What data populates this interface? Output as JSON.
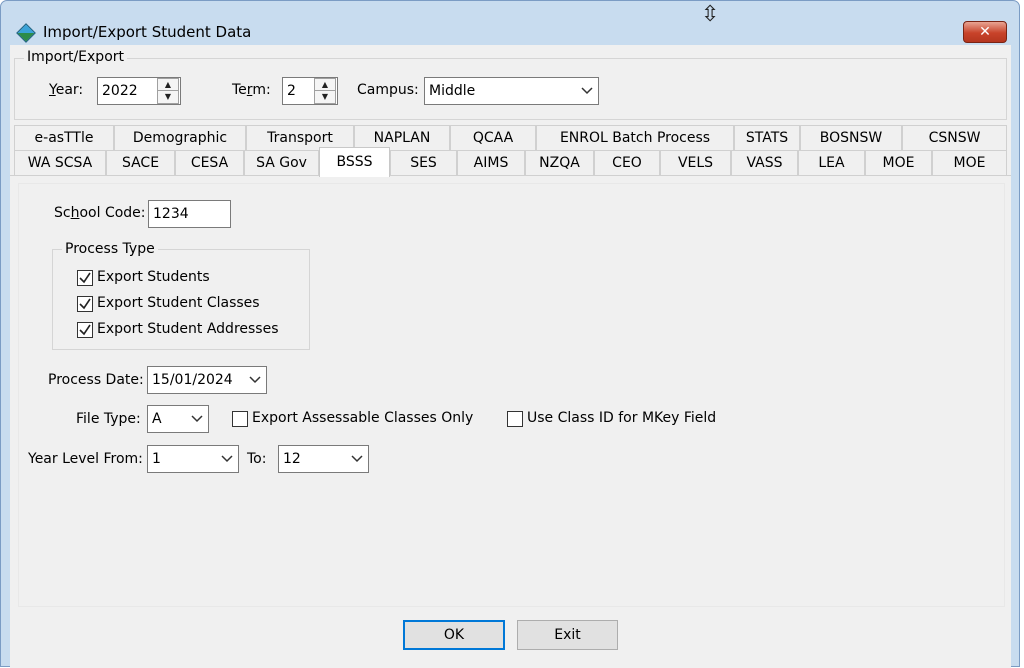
{
  "window": {
    "title": "Import/Export Student Data",
    "close_glyph": "✕",
    "cursor_glyph": "⇳"
  },
  "import_export": {
    "legend": "Import/Export",
    "year_label_pre": "",
    "year_label_key": "Y",
    "year_label_post": "ear:",
    "year_value": "2022",
    "term_label_pre": "Te",
    "term_label_key": "r",
    "term_label_post": "m:",
    "term_value": "2",
    "campus_label": "Campus:",
    "campus_value": "Middle"
  },
  "tabs_row1": [
    "e-asTTle",
    "Demographic",
    "Transport",
    "NAPLAN",
    "QCAA",
    "ENROL Batch Process",
    "STATS",
    "BOSNSW",
    "CSNSW"
  ],
  "tabs_row2": [
    "WA SCSA",
    "SACE",
    "CESA",
    "SA Gov",
    "BSSS",
    "SES",
    "AIMS",
    "NZQA",
    "CEO",
    "VELS",
    "VASS",
    "LEA",
    "MOE",
    "MOE"
  ],
  "active_tab": "BSSS",
  "form": {
    "school_code_label_pre": "Sc",
    "school_code_label_key": "h",
    "school_code_label_post": "ool Code:",
    "school_code_value": "1234",
    "process_type_legend": "Process Type",
    "export_students": "Export Students",
    "export_student_classes": "Export Student Classes",
    "export_student_addresses": "Export Student Addresses",
    "export_students_checked": true,
    "export_student_classes_checked": true,
    "export_student_addresses_checked": true,
    "process_date_label": "Process Date:",
    "process_date_value": "15/01/2024",
    "file_type_label": "File Type:",
    "file_type_value": "A",
    "export_assessable_label": "Export Assessable Classes Only",
    "export_assessable_checked": false,
    "use_class_id_label": "Use Class ID for MKey Field",
    "use_class_id_checked": false,
    "year_level_from_label": "Year Level From:",
    "year_level_from_value": "1",
    "to_label": "To:",
    "year_level_to_value": "12"
  },
  "buttons": {
    "ok": "OK",
    "exit": "Exit"
  },
  "colors": {
    "window_frame": "#c8dcef",
    "close_button": "#c8432a",
    "default_button_border": "#0078d7"
  }
}
